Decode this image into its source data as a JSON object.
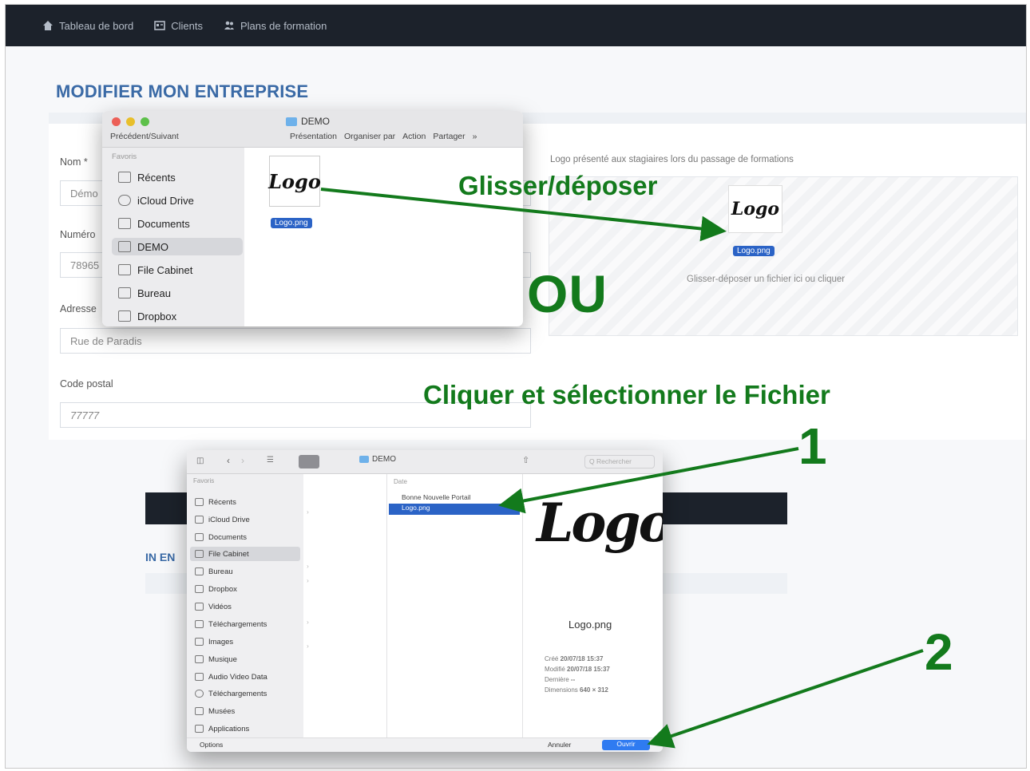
{
  "nav": {
    "items": [
      {
        "label": "Tableau de bord",
        "icon": "home-icon"
      },
      {
        "label": "Clients",
        "icon": "id-card-icon"
      },
      {
        "label": "Plans de formation",
        "icon": "users-icon"
      }
    ]
  },
  "page": {
    "title": "MODIFIER MON ENTREPRISE"
  },
  "form": {
    "name_label": "Nom *",
    "name_value": "Démo",
    "number_label": "Numéro",
    "number_value": "78965",
    "address_label": "Adresse",
    "address_value": "Rue de Paradis",
    "postal_label": "Code postal",
    "postal_value": "77777"
  },
  "logo_zone": {
    "hint": "Logo présenté aux stagiaires lors du passage de formations",
    "drop_text": "Glisser-déposer un fichier ici ou cliquer",
    "file_tag": "Logo.png"
  },
  "finder": {
    "favorites_label": "Favoris",
    "previous_label": "Précédent/Suivant",
    "folder_title": "DEMO",
    "toolbar": [
      "Présentation",
      "Organiser par",
      "Action",
      "Partager"
    ],
    "sidebar": [
      "Récents",
      "iCloud Drive",
      "Documents",
      "DEMO",
      "File Cabinet",
      "Bureau",
      "Dropbox"
    ],
    "selected": "DEMO",
    "file_tag": "Logo.png"
  },
  "annotations": {
    "drag_drop": "Glisser/déposer",
    "or": "OU",
    "click_select": "Cliquer et sélectionner le Fichier",
    "step1": "1",
    "step2": "2",
    "color": "#137a1c"
  },
  "dialog": {
    "folder": "DEMO",
    "sidebar_header": "Favoris",
    "sidebar": [
      "Récents",
      "iCloud Drive",
      "Documents",
      "File Cabinet",
      "Bureau",
      "Dropbox",
      "Vidéos",
      "Téléchargements",
      "Images",
      "Musique",
      "Audio Video Data",
      "Téléchargements",
      "Musées",
      "Applications"
    ],
    "column3_header": "Date",
    "files": [
      "Bonne Nouvelle Portail",
      "Logo.png"
    ],
    "selected_file": "Logo.png",
    "preview_name": "Logo.png",
    "preview_meta": [
      {
        "k": "Créé",
        "v": "20/07/18 15:37"
      },
      {
        "k": "Modifié",
        "v": "20/07/18 15:37"
      },
      {
        "k": "Dernière",
        "v": "--"
      },
      {
        "k": "Dimensions",
        "v": "640 × 312"
      }
    ],
    "options_label": "Options",
    "cancel_label": "Annuler",
    "open_label": "Ouvrir",
    "search_label": "Q Rechercher"
  },
  "bg_page": {
    "title": "IN EN"
  }
}
